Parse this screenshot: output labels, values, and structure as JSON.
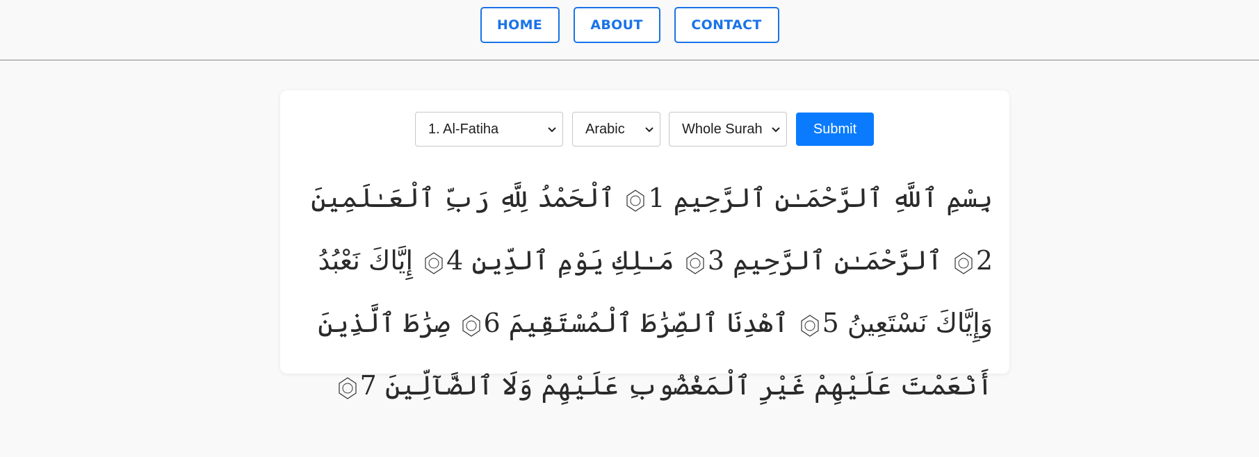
{
  "nav": {
    "home": "HOME",
    "about": "ABOUT",
    "contact": "CONTACT"
  },
  "form": {
    "surah_value": "1. Al-Fatiha",
    "language_value": "Arabic",
    "range_value": "Whole Surah",
    "submit_label": "Submit"
  },
  "verses": [
    {
      "text": "بِسْمِ ٱللَّهِ ٱلرَّحْمَـٰنِ ٱلرَّحِيمِ",
      "num": "1"
    },
    {
      "text": "ٱلْحَمْدُ لِلَّهِ رَبِّ ٱلْعَـٰلَمِينَ",
      "num": "2"
    },
    {
      "text": "ٱلرَّحْمَـٰنِ ٱلرَّحِيمِ",
      "num": "3"
    },
    {
      "text": "مَـٰلِكِ يَوْمِ ٱلدِّينِ",
      "num": "4"
    },
    {
      "text": "إِيَّاكَ نَعْبُدُ وَإِيَّاكَ نَسْتَعِينُ",
      "num": "5"
    },
    {
      "text": "ٱهْدِنَا ٱلصِّرَٰطَ ٱلْمُسْتَقِيمَ",
      "num": "6"
    },
    {
      "text": "صِرَٰطَ ٱلَّذِينَ أَنْعَمْتَ عَلَيْهِمْ غَيْرِ ٱلْمَغْضُوبِ عَلَيْهِمْ وَلَا ٱلضَّآلِّينَ",
      "num": "7"
    }
  ],
  "colors": {
    "accent": "#1a73e8",
    "submit_bg": "#0a7bff",
    "page_bg": "#f9f9f9"
  }
}
